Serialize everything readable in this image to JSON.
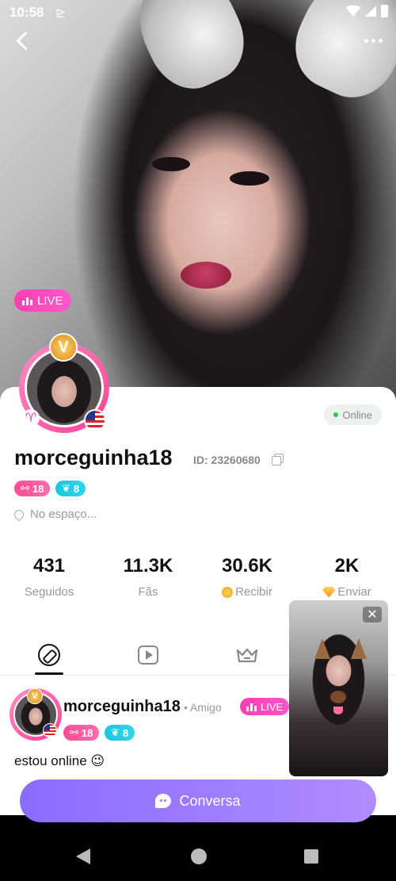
{
  "status_bar": {
    "time": "10:58",
    "cast_glyph": "⊵"
  },
  "hero": {
    "live_label": "LIVE"
  },
  "profile": {
    "crown_letter": "V",
    "zodiac_glyph": "♈",
    "online_label": "Online",
    "username": "morceguinha18",
    "id_text": "ID: 23260680",
    "level_pink": "18",
    "level_cyan": "8",
    "location": "No espaço...",
    "stats": [
      {
        "value": "431",
        "label": "Seguidos"
      },
      {
        "value": "11.3K",
        "label": "Fãs"
      },
      {
        "value": "30.6K",
        "label": "Recibir"
      },
      {
        "value": "2K",
        "label": "Enviar"
      }
    ]
  },
  "tabs": [
    "compass-icon",
    "video-icon",
    "crown-icon"
  ],
  "post": {
    "name": "morceguinha18",
    "relation": "• Amigo",
    "live_label": "LIVE",
    "level_pink": "18",
    "level_cyan": "8",
    "text": "estou online 😉"
  },
  "pip": {
    "close_glyph": "✕"
  },
  "chat_button": {
    "label": "Conversa"
  },
  "colors": {
    "accent_pink": "#ff3fb1",
    "accent_purple": "#8a6bff",
    "cyan": "#18c7de"
  }
}
